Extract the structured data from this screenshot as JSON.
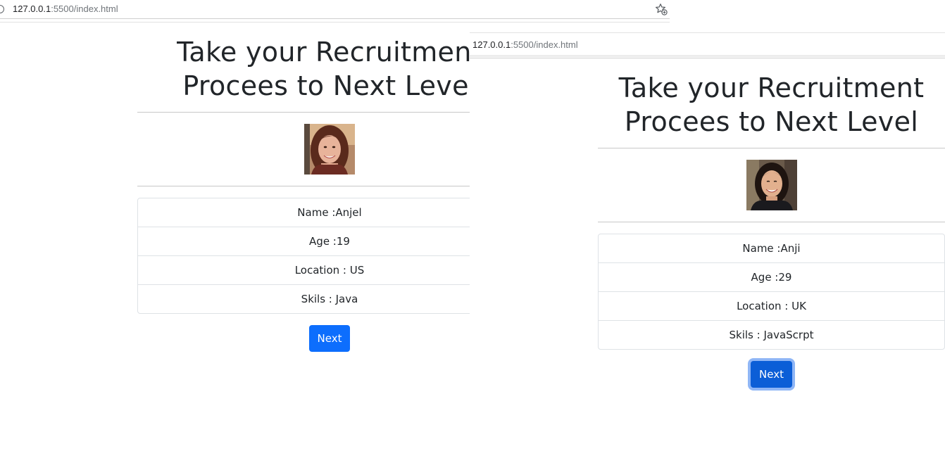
{
  "windows": [
    {
      "address": {
        "host": "127.0.0.1",
        "path": ":5500/index.html"
      },
      "page": {
        "title_line1": "Take your Recruitment",
        "title_line2": "Procees to Next Level",
        "candidate": {
          "name": "Name :Anjel",
          "age": "Age :19",
          "location": "Location : US",
          "skills": "Skils : Java"
        },
        "next_label": "Next"
      }
    },
    {
      "address": {
        "host": "127.0.0.1",
        "path": ":5500/index.html"
      },
      "page": {
        "title_line1": "Take your Recruitment",
        "title_line2": "Procees to Next Level",
        "candidate": {
          "name": "Name :Anji",
          "age": "Age :29",
          "location": "Location : UK",
          "skills": "Skils : JavaScrpt"
        },
        "next_label": "Next"
      }
    }
  ],
  "icons": {
    "bookmark": "star-plus-icon",
    "site_info": "info-icon"
  },
  "colors": {
    "primary": "#0d6efd",
    "focus_ring": "#8fb6f6",
    "text": "#212529",
    "border": "#dee2e6"
  }
}
